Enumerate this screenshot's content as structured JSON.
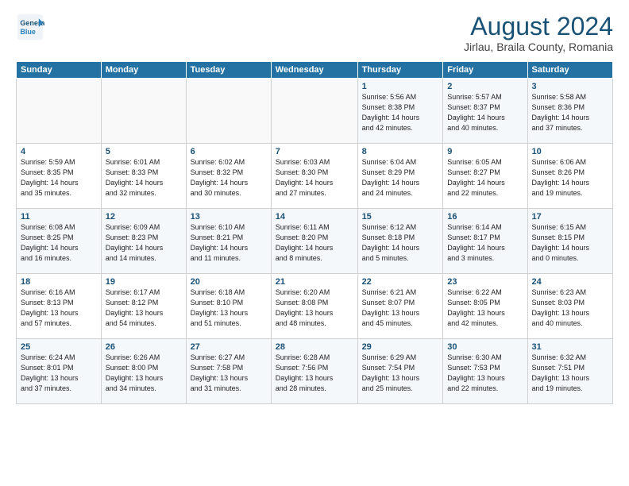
{
  "header": {
    "logo_line1": "General",
    "logo_line2": "Blue",
    "month": "August 2024",
    "location": "Jirlau, Braila County, Romania"
  },
  "days_of_week": [
    "Sunday",
    "Monday",
    "Tuesday",
    "Wednesday",
    "Thursday",
    "Friday",
    "Saturday"
  ],
  "weeks": [
    [
      {
        "day": "",
        "info": ""
      },
      {
        "day": "",
        "info": ""
      },
      {
        "day": "",
        "info": ""
      },
      {
        "day": "",
        "info": ""
      },
      {
        "day": "1",
        "info": "Sunrise: 5:56 AM\nSunset: 8:38 PM\nDaylight: 14 hours\nand 42 minutes."
      },
      {
        "day": "2",
        "info": "Sunrise: 5:57 AM\nSunset: 8:37 PM\nDaylight: 14 hours\nand 40 minutes."
      },
      {
        "day": "3",
        "info": "Sunrise: 5:58 AM\nSunset: 8:36 PM\nDaylight: 14 hours\nand 37 minutes."
      }
    ],
    [
      {
        "day": "4",
        "info": "Sunrise: 5:59 AM\nSunset: 8:35 PM\nDaylight: 14 hours\nand 35 minutes."
      },
      {
        "day": "5",
        "info": "Sunrise: 6:01 AM\nSunset: 8:33 PM\nDaylight: 14 hours\nand 32 minutes."
      },
      {
        "day": "6",
        "info": "Sunrise: 6:02 AM\nSunset: 8:32 PM\nDaylight: 14 hours\nand 30 minutes."
      },
      {
        "day": "7",
        "info": "Sunrise: 6:03 AM\nSunset: 8:30 PM\nDaylight: 14 hours\nand 27 minutes."
      },
      {
        "day": "8",
        "info": "Sunrise: 6:04 AM\nSunset: 8:29 PM\nDaylight: 14 hours\nand 24 minutes."
      },
      {
        "day": "9",
        "info": "Sunrise: 6:05 AM\nSunset: 8:27 PM\nDaylight: 14 hours\nand 22 minutes."
      },
      {
        "day": "10",
        "info": "Sunrise: 6:06 AM\nSunset: 8:26 PM\nDaylight: 14 hours\nand 19 minutes."
      }
    ],
    [
      {
        "day": "11",
        "info": "Sunrise: 6:08 AM\nSunset: 8:25 PM\nDaylight: 14 hours\nand 16 minutes."
      },
      {
        "day": "12",
        "info": "Sunrise: 6:09 AM\nSunset: 8:23 PM\nDaylight: 14 hours\nand 14 minutes."
      },
      {
        "day": "13",
        "info": "Sunrise: 6:10 AM\nSunset: 8:21 PM\nDaylight: 14 hours\nand 11 minutes."
      },
      {
        "day": "14",
        "info": "Sunrise: 6:11 AM\nSunset: 8:20 PM\nDaylight: 14 hours\nand 8 minutes."
      },
      {
        "day": "15",
        "info": "Sunrise: 6:12 AM\nSunset: 8:18 PM\nDaylight: 14 hours\nand 5 minutes."
      },
      {
        "day": "16",
        "info": "Sunrise: 6:14 AM\nSunset: 8:17 PM\nDaylight: 14 hours\nand 3 minutes."
      },
      {
        "day": "17",
        "info": "Sunrise: 6:15 AM\nSunset: 8:15 PM\nDaylight: 14 hours\nand 0 minutes."
      }
    ],
    [
      {
        "day": "18",
        "info": "Sunrise: 6:16 AM\nSunset: 8:13 PM\nDaylight: 13 hours\nand 57 minutes."
      },
      {
        "day": "19",
        "info": "Sunrise: 6:17 AM\nSunset: 8:12 PM\nDaylight: 13 hours\nand 54 minutes."
      },
      {
        "day": "20",
        "info": "Sunrise: 6:18 AM\nSunset: 8:10 PM\nDaylight: 13 hours\nand 51 minutes."
      },
      {
        "day": "21",
        "info": "Sunrise: 6:20 AM\nSunset: 8:08 PM\nDaylight: 13 hours\nand 48 minutes."
      },
      {
        "day": "22",
        "info": "Sunrise: 6:21 AM\nSunset: 8:07 PM\nDaylight: 13 hours\nand 45 minutes."
      },
      {
        "day": "23",
        "info": "Sunrise: 6:22 AM\nSunset: 8:05 PM\nDaylight: 13 hours\nand 42 minutes."
      },
      {
        "day": "24",
        "info": "Sunrise: 6:23 AM\nSunset: 8:03 PM\nDaylight: 13 hours\nand 40 minutes."
      }
    ],
    [
      {
        "day": "25",
        "info": "Sunrise: 6:24 AM\nSunset: 8:01 PM\nDaylight: 13 hours\nand 37 minutes."
      },
      {
        "day": "26",
        "info": "Sunrise: 6:26 AM\nSunset: 8:00 PM\nDaylight: 13 hours\nand 34 minutes."
      },
      {
        "day": "27",
        "info": "Sunrise: 6:27 AM\nSunset: 7:58 PM\nDaylight: 13 hours\nand 31 minutes."
      },
      {
        "day": "28",
        "info": "Sunrise: 6:28 AM\nSunset: 7:56 PM\nDaylight: 13 hours\nand 28 minutes."
      },
      {
        "day": "29",
        "info": "Sunrise: 6:29 AM\nSunset: 7:54 PM\nDaylight: 13 hours\nand 25 minutes."
      },
      {
        "day": "30",
        "info": "Sunrise: 6:30 AM\nSunset: 7:53 PM\nDaylight: 13 hours\nand 22 minutes."
      },
      {
        "day": "31",
        "info": "Sunrise: 6:32 AM\nSunset: 7:51 PM\nDaylight: 13 hours\nand 19 minutes."
      }
    ]
  ]
}
